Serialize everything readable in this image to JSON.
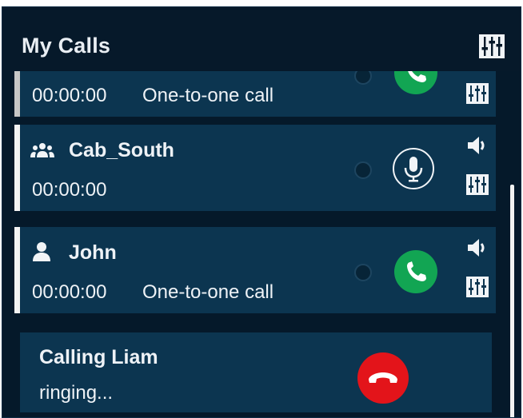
{
  "header": {
    "title": "My Calls",
    "mixer_icon": "mixer-icon"
  },
  "calls": [
    {
      "name": "",
      "timer": "00:00:00",
      "type": "One-to-one call",
      "action": "accept-call"
    },
    {
      "name": "Cab_South",
      "timer": "00:00:00",
      "type": "",
      "kind": "group",
      "action": "push-to-talk"
    },
    {
      "name": "John",
      "timer": "00:00:00",
      "type": "One-to-one call",
      "kind": "person",
      "action": "accept-call"
    }
  ],
  "outgoing": {
    "line1": "Calling  Liam",
    "line2": "ringing...",
    "action": "hang-up"
  },
  "colors": {
    "panel": "#05192a",
    "card": "#0c3550",
    "green": "#12a553",
    "red": "#e3141a",
    "accent": "#f3f3f3"
  }
}
